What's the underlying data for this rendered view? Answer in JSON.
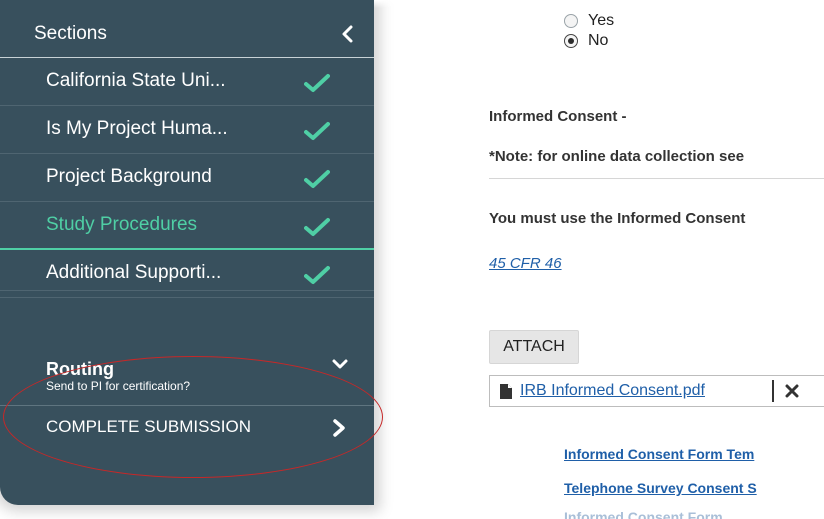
{
  "sidebar": {
    "title": "Sections",
    "items": [
      {
        "label": "California State Uni..."
      },
      {
        "label": "Is My Project Huma..."
      },
      {
        "label": "Project Background"
      },
      {
        "label": "Study Procedures",
        "active": true
      },
      {
        "label": "Additional Supporti..."
      }
    ],
    "routing": {
      "title": "Routing",
      "subtitle": "Send to PI for certification?"
    },
    "complete": {
      "label": "COMPLETE SUBMISSION"
    }
  },
  "main": {
    "radio": {
      "options": [
        {
          "label": "Yes",
          "checked": false
        },
        {
          "label": "No",
          "checked": true
        }
      ]
    },
    "informed_consent_heading": "Informed Consent -",
    "note": "*Note: for online data collection see",
    "must_use": "You must use the Informed Consent",
    "cfr_link": "45 CFR 46",
    "attach_label": "ATTACH",
    "attachment_name": "IRB Informed Consent.pdf",
    "links": [
      "Informed Consent Form Tem",
      "Telephone Survey Consent S",
      "Informed Consent Form"
    ]
  },
  "colors": {
    "sidebar_bg": "#38505d",
    "accent": "#4fcfa5",
    "link": "#1f5fa8",
    "annotation": "#c62828"
  },
  "icons": [
    "chevron-left-icon",
    "check-icon",
    "chevron-down-icon",
    "chevron-right-icon",
    "file-icon",
    "close-icon"
  ]
}
